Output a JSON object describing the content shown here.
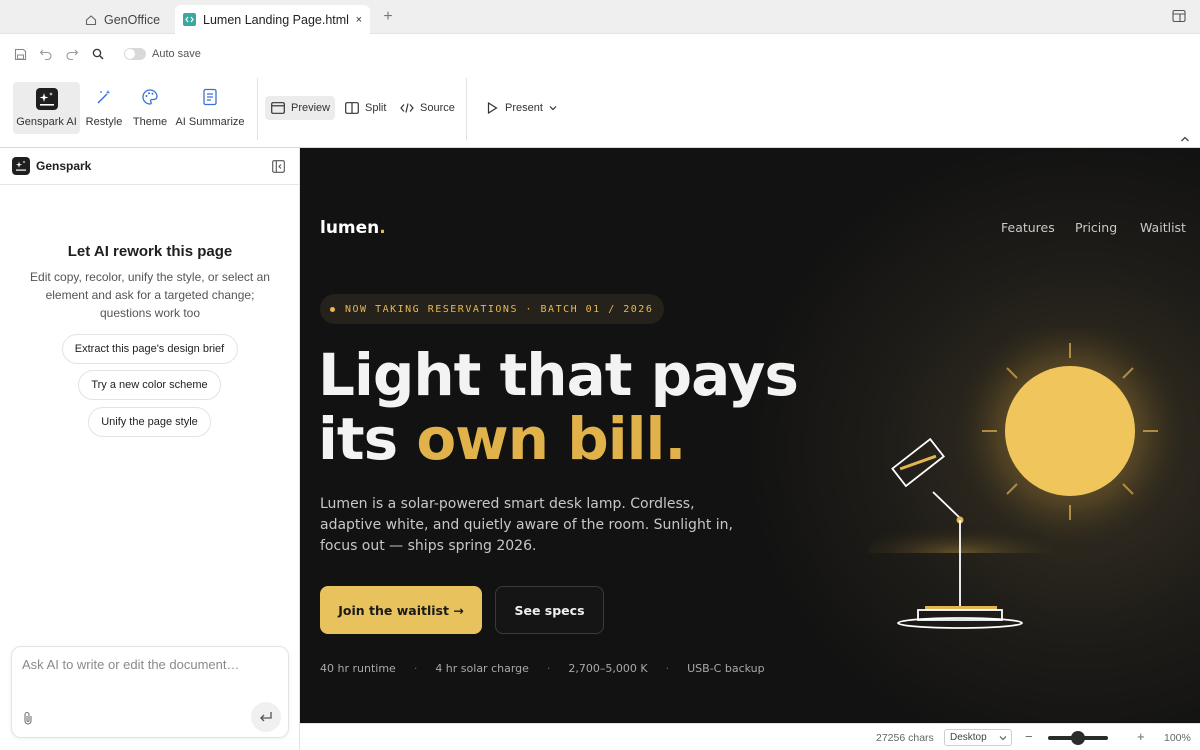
{
  "tabs": [
    {
      "label": "GenOffice",
      "icon": "home-icon"
    },
    {
      "label": "Lumen Landing Page.html",
      "icon": "code-file-icon",
      "active": true,
      "close": "×"
    }
  ],
  "tab_add": "+",
  "quickbar": {
    "autosave_label": "Auto save",
    "autosave_on": false
  },
  "ribbon": {
    "genspark_ai": "Genspark AI",
    "restyle": "Restyle",
    "theme": "Theme",
    "ai_summarize": "AI Summarize",
    "preview": "Preview",
    "split": "Split",
    "source": "Source",
    "present": "Present"
  },
  "sidebar": {
    "title": "Genspark",
    "heading": "Let AI rework this page",
    "description": "Edit copy, recolor, unify the style, or select an element and ask for a targeted change; questions work too",
    "suggestions": [
      "Extract this page's design brief",
      "Try a new color scheme",
      "Unify the page style"
    ],
    "ask_placeholder": "Ask AI to write or edit the document…"
  },
  "preview": {
    "logo": "lumen",
    "logo_dot": ".",
    "nav": [
      "Features",
      "Pricing",
      "Waitlist"
    ],
    "badge": "NOW TAKING RESERVATIONS · BATCH 01 / 2026",
    "headline_line1": "Light that pays",
    "headline_line2_white": "its ",
    "headline_line2_gold": "own bill.",
    "subtext": "Lumen is a solar-powered smart desk lamp. Cordless, adaptive white, and quietly aware of the room. Sunlight in, focus out — ships spring 2026.",
    "cta_primary": "Join the waitlist →",
    "cta_secondary": "See specs",
    "stats": [
      "40 hr runtime",
      "4 hr solar charge",
      "2,700–5,000 K",
      "USB-C backup"
    ],
    "stat_separator": "·"
  },
  "statusbar": {
    "chars": "27256 chars",
    "device": "Desktop",
    "zoom_minus": "−",
    "zoom_plus": "+",
    "zoom": "100%",
    "zoom_fraction": 0.5
  },
  "colors": {
    "accent_gold": "#e8c25c",
    "headline_gold": "#e2b24a",
    "preview_bg": "#121212"
  }
}
